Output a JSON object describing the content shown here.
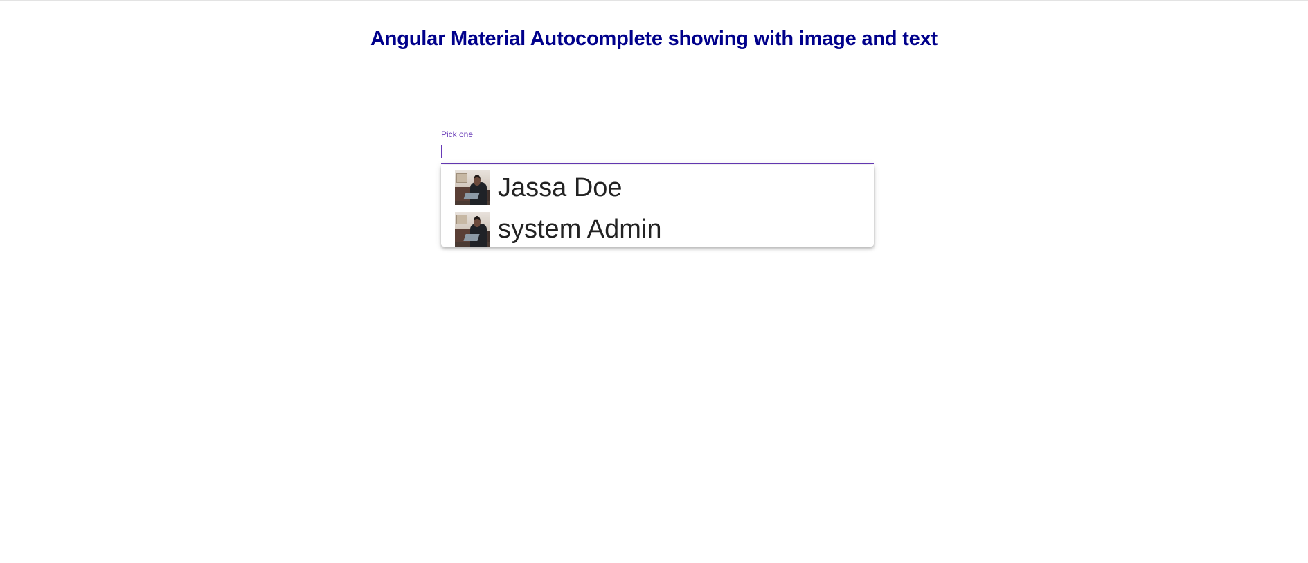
{
  "page": {
    "title": "Angular Material Autocomplete showing with image and text"
  },
  "form": {
    "label": "Pick one",
    "input_value": ""
  },
  "autocomplete": {
    "options": [
      {
        "label": "Jassa Doe",
        "icon": "user-avatar-photo"
      },
      {
        "label": "system Admin",
        "icon": "user-avatar-photo"
      }
    ]
  },
  "colors": {
    "title": "#00008b",
    "accent": "#673ab7",
    "option_text": "#222222"
  }
}
